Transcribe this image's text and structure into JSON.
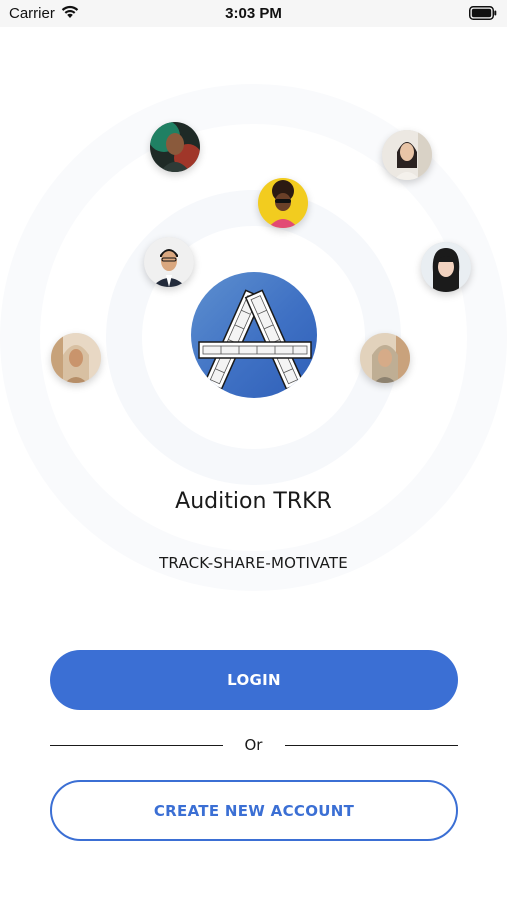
{
  "status_bar": {
    "carrier": "Carrier",
    "time": "3:03 PM",
    "wifi_icon": "wifi-icon",
    "battery_icon": "battery-icon"
  },
  "app": {
    "title": "Audition TRKR",
    "tagline": "TRACK-SHARE-MOTIVATE",
    "logo_icon": "film-strip-a-logo"
  },
  "avatars": [
    {
      "name": "avatar-1"
    },
    {
      "name": "avatar-2"
    },
    {
      "name": "avatar-3"
    },
    {
      "name": "avatar-4"
    },
    {
      "name": "avatar-5"
    },
    {
      "name": "avatar-6"
    },
    {
      "name": "avatar-7"
    }
  ],
  "actions": {
    "login_label": "LOGIN",
    "divider_label": "Or",
    "create_account_label": "CREATE NEW ACCOUNT"
  },
  "colors": {
    "accent": "#3b6fd4",
    "background": "#ffffff",
    "text": "#1a1a1a"
  }
}
